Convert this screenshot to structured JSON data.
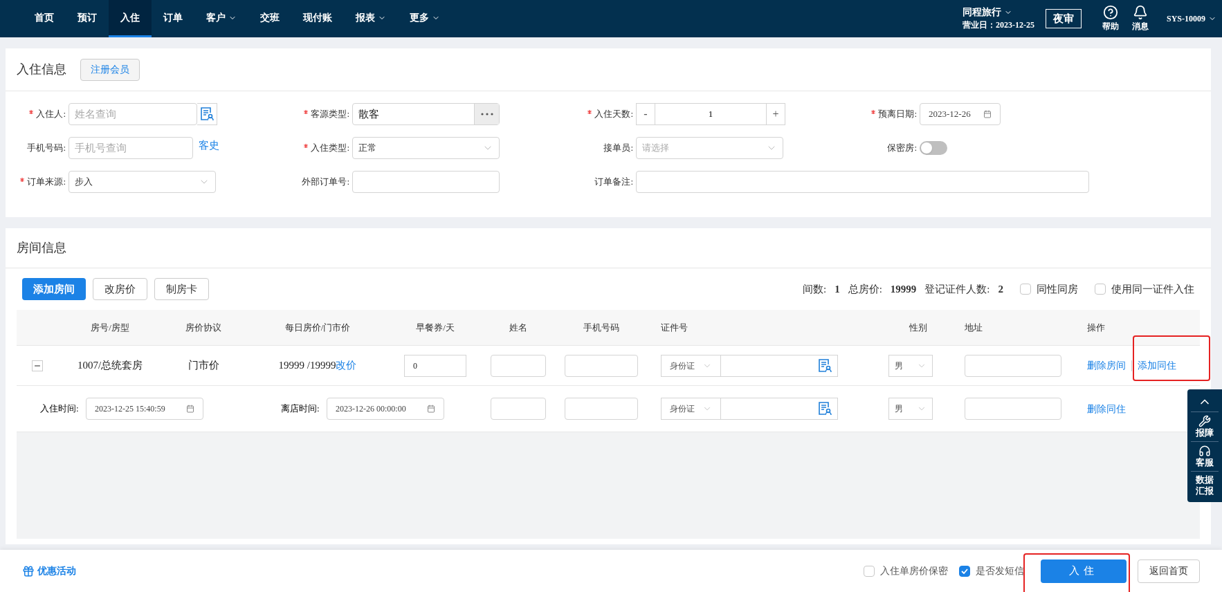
{
  "nav": {
    "items": [
      {
        "label": "首页",
        "dropdown": false,
        "selected": false
      },
      {
        "label": "预订",
        "dropdown": false,
        "selected": false
      },
      {
        "label": "入住",
        "dropdown": false,
        "selected": true
      },
      {
        "label": "订单",
        "dropdown": false,
        "selected": false
      },
      {
        "label": "客户",
        "dropdown": true,
        "selected": false
      },
      {
        "label": "交班",
        "dropdown": false,
        "selected": false
      },
      {
        "label": "现付账",
        "dropdown": false,
        "selected": false
      },
      {
        "label": "报表",
        "dropdown": true,
        "selected": false
      },
      {
        "label": "更多",
        "dropdown": true,
        "selected": false
      }
    ],
    "hotel": {
      "name": "同程旅行",
      "business_day": "营业日：2023-12-25"
    },
    "night_audit": "夜审",
    "help": "帮助",
    "messages": "消息",
    "user": "SYS-10009"
  },
  "checkin_info": {
    "title": "入住信息",
    "register_button": "注册会员",
    "fields": [
      {
        "kind": "search",
        "label": "入住人:",
        "required": true,
        "placeholder": "姓名查询"
      },
      {
        "kind": "dots",
        "label": "客源类型:",
        "required": true,
        "value": "散客"
      },
      {
        "kind": "stepper",
        "label": "入住天数:",
        "required": true,
        "value": "1",
        "minus": "-",
        "plus": "+"
      },
      {
        "kind": "date",
        "label": "预离日期:",
        "required": true,
        "value": "2023-12-26"
      },
      {
        "kind": "link-input",
        "label": "手机号码:",
        "required": false,
        "placeholder": "手机号查询",
        "link": "客史"
      },
      {
        "kind": "select",
        "label": "入住类型:",
        "required": true,
        "value": "正常"
      },
      {
        "kind": "select",
        "label": "接单员:",
        "required": false,
        "placeholder": "请选择"
      },
      {
        "kind": "toggle",
        "label": "保密房:",
        "required": false,
        "on": false
      },
      {
        "kind": "select",
        "label": "订单来源:",
        "required": true,
        "value": "步入"
      },
      {
        "kind": "input",
        "label": "外部订单号:",
        "required": false
      },
      {
        "kind": "wide-input",
        "label": "订单备注:",
        "required": false
      }
    ]
  },
  "room_info": {
    "title": "房间信息",
    "buttons": [
      {
        "label": "添加房间",
        "primary": true
      },
      {
        "label": "改房价",
        "primary": false
      },
      {
        "label": "制房卡",
        "primary": false
      }
    ],
    "summary": [
      {
        "label": "间数:",
        "value": "1"
      },
      {
        "label": "总房价:",
        "value": "19999"
      },
      {
        "label": "登记证件人数:",
        "value": "2"
      }
    ],
    "options": [
      {
        "label": "同性同房",
        "checked": false
      },
      {
        "label": "使用同一证件入住",
        "checked": false
      }
    ],
    "columns": [
      "房号/房型",
      "房价协议",
      "每日房价/门市价",
      "早餐券/天",
      "姓名",
      "手机号码",
      "证件号",
      "性别",
      "地址",
      "操作"
    ],
    "rows": [
      {
        "kind": "room",
        "expanded": true,
        "room": "1007/总统套房",
        "protocol": "门市价",
        "price": "19999 /19999",
        "change_price": "改价",
        "breakfast": "0",
        "id_type": "身份证",
        "gender": "男",
        "actions": [
          "删除房间",
          "添加同住"
        ]
      },
      {
        "kind": "times",
        "checkin_label": "入住时间:",
        "checkin_time": "2023-12-25 15:40:59",
        "checkout_label": "离店时间:",
        "checkout_time": "2023-12-26 00:00:00",
        "id_type": "身份证",
        "gender": "男",
        "actions": [
          "删除同住"
        ]
      }
    ]
  },
  "side_panel": {
    "items": [
      "报障",
      "客服",
      "数据汇报"
    ]
  },
  "footer": {
    "promo": "优惠活动",
    "options": [
      {
        "label": "入住单房价保密",
        "checked": false
      },
      {
        "label": "是否发短信",
        "checked": true
      }
    ],
    "submit": "入住",
    "back": "返回首页"
  }
}
